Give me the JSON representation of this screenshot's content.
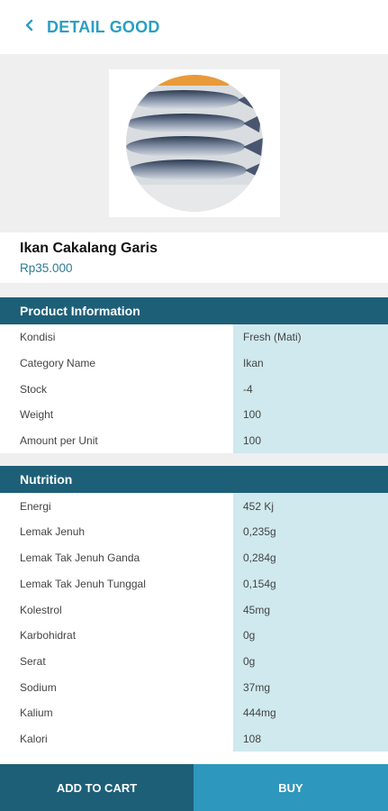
{
  "header": {
    "title": "DETAIL GOOD",
    "back_icon": "chevron-left-icon",
    "accent": "#2a9fc4"
  },
  "product": {
    "name": "Ikan Cakalang Garis",
    "price": "Rp35.000"
  },
  "product_info": {
    "title": "Product Information",
    "rows": [
      {
        "label": "Kondisi",
        "value": "Fresh (Mati)"
      },
      {
        "label": "Category Name",
        "value": "Ikan"
      },
      {
        "label": "Stock",
        "value": "-4"
      },
      {
        "label": "Weight",
        "value": "100"
      },
      {
        "label": "Amount per Unit",
        "value": "100"
      }
    ]
  },
  "nutrition": {
    "title": "Nutrition",
    "rows": [
      {
        "label": "Energi",
        "value": "452 Kj"
      },
      {
        "label": "Lemak Jenuh",
        "value": "0,235g"
      },
      {
        "label": "Lemak Tak Jenuh Ganda",
        "value": "0,284g"
      },
      {
        "label": "Lemak Tak Jenuh Tunggal",
        "value": "0,154g"
      },
      {
        "label": "Kolestrol",
        "value": "45mg"
      },
      {
        "label": "Karbohidrat",
        "value": "0g"
      },
      {
        "label": "Serat",
        "value": "0g"
      },
      {
        "label": "Sodium",
        "value": "37mg"
      },
      {
        "label": "Kalium",
        "value": "444mg"
      },
      {
        "label": "Kalori",
        "value": "108"
      }
    ]
  },
  "actions": {
    "add_to_cart": "ADD TO CART",
    "buy": "BUY"
  },
  "colors": {
    "section_header": "#1e5f78",
    "value_cell": "#cfe9ee",
    "buy": "#2e97bd"
  }
}
